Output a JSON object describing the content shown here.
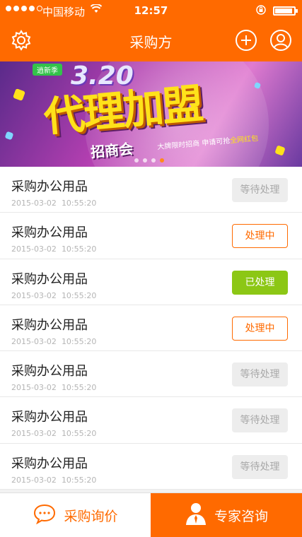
{
  "status_bar": {
    "carrier": "中国移动",
    "time": "12:57"
  },
  "nav": {
    "title": "采购方",
    "icons": [
      "gear-icon",
      "plus-circle-icon",
      "user-icon"
    ]
  },
  "banner": {
    "tag": "逍新季",
    "year": "3.20",
    "headline": "代理加盟",
    "subline": "招商会",
    "slogan_prefix": "大牌限时招商 申请可抢",
    "slogan_highlight": "全网红包",
    "page_count": 4,
    "active_page": 4
  },
  "list": {
    "items": [
      {
        "title": "采购办公用品",
        "date": "2015-03-02",
        "clock": "10:55:20",
        "status": "等待处理",
        "status_type": "pending"
      },
      {
        "title": "采购办公用品",
        "date": "2015-03-02",
        "clock": "10:55:20",
        "status": "处理中",
        "status_type": "processing"
      },
      {
        "title": "采购办公用品",
        "date": "2015-03-02",
        "clock": "10:55:20",
        "status": "已处理",
        "status_type": "done"
      },
      {
        "title": "采购办公用品",
        "date": "2015-03-02",
        "clock": "10:55:20",
        "status": "处理中",
        "status_type": "processing"
      },
      {
        "title": "采购办公用品",
        "date": "2015-03-02",
        "clock": "10:55:20",
        "status": "等待处理",
        "status_type": "pending"
      },
      {
        "title": "采购办公用品",
        "date": "2015-03-02",
        "clock": "10:55:20",
        "status": "等待处理",
        "status_type": "pending"
      },
      {
        "title": "采购办公用品",
        "date": "2015-03-02",
        "clock": "10:55:20",
        "status": "等待处理",
        "status_type": "pending"
      }
    ]
  },
  "tabbar": {
    "inquiry_label": "采购询价",
    "expert_label": "专家咨询"
  },
  "colors": {
    "accent": "#ff6a00",
    "done_green": "#8cc715",
    "pending_gray": "#ededed"
  }
}
